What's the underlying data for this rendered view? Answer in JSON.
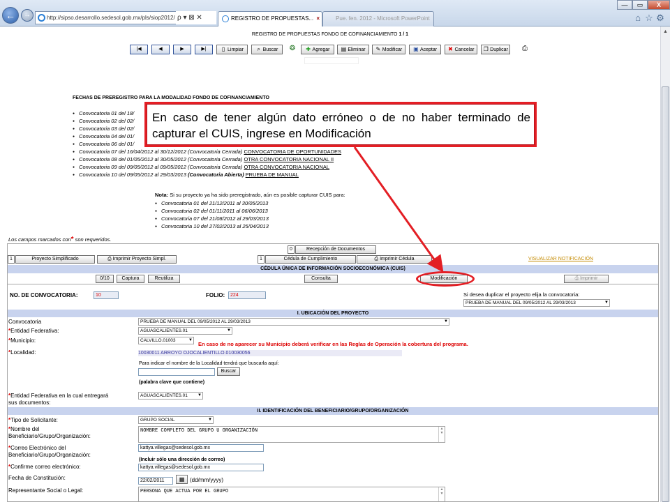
{
  "browser": {
    "address": "http://sipso.desarrollo.sedesol.gob.mx/pls/siop2012/",
    "address_suffix": "ρ ▾ ⊠ ✕",
    "active_tab": "REGISTRO DE PROPUESTAS...",
    "inactive_tab": "Pue. fen. 2012 - Microsoft PowerPoint",
    "window_controls": [
      "—",
      "▭",
      "X"
    ],
    "tool_icons": [
      "home-icon",
      "star-icon",
      "gear-icon"
    ],
    "back_glyph": "←",
    "forward_glyph": "→"
  },
  "page": {
    "title_prefix": "REGISTRO DE PROPUESTAS FONDO DE COFINANCIAMIENTO ",
    "title_page": "1 / 1",
    "toolbar": {
      "first": "|◀",
      "prev": "◀",
      "next": "▶",
      "last": "▶|",
      "limpiar": "Limpiar",
      "buscar": "Buscar",
      "agregar": "Agregar",
      "eliminar": "Eliminar",
      "modificar": "Modificar",
      "aceptar": "Aceptar",
      "cancelar": "Cancelar",
      "duplicar": "Duplicar"
    },
    "fechas_heading": "FECHAS DE PREREGISTRO PARA LA MODALIDAD FONDO DE COFINANCIAMIENTO",
    "convocatorias": [
      {
        "text": "Convocatoria 01 del 18/",
        "link": ""
      },
      {
        "text": "Convocatoria 02 del 02/",
        "link": ""
      },
      {
        "text": "Convocatoria 03 del 02/",
        "link": ""
      },
      {
        "text": "Convocatoria 04 del 01/",
        "link": ""
      },
      {
        "text": "Convocatoria 06 del 01/",
        "link": ""
      },
      {
        "text": "Convocatoria 07 del 16/04/2012 al 30/12/2012 (Convocatoria Cerrada) ",
        "link": "CONVOCATORIA DE OPORTUNIDADES"
      },
      {
        "text": "Convocatoria 08 del 01/05/2012 al 30/05/2012 (Convocatoria Cerrada) ",
        "link": "OTRA CONVOCATORIA NACIONAL II"
      },
      {
        "text": "Convocatoria 09 del 09/05/2012 al 09/05/2012 (Convocatoria Cerrada) ",
        "link": "OTRA CONVOCATORIA NACIONAL"
      },
      {
        "text": "Convocatoria 10 del 09/05/2012 al 29/03/2013 ",
        "bold": "(Convocatoria Abierta)",
        "link": "PRUEBA DE MANUAL"
      }
    ],
    "nota_label": "Nota:",
    "nota_text": " Si su proyecto ya ha sido preregistrado, aún es posible capturar CUIS para:",
    "nota_items": [
      "Convocatoria 01 del 21/12/2011 al 30/05/2013",
      "Convocatoria 02 del 01/11/2011 al 06/06/2013",
      "Convocatoria 07 del 21/08/2012 al 29/03/2013",
      "Convocatoria 10 del 27/02/2013 al 25/04/2013"
    ],
    "required_note_a": "Los campos marcados con",
    "required_note_star": "*",
    "required_note_b": " son requeridos."
  },
  "callout": {
    "text": "En caso de tener algún dato erróneo o de no haber terminado de capturar el CUIS, ingrese en Modificación"
  },
  "form": {
    "docs_count": "0",
    "recepcion": "Recepción de Documentos",
    "proj_count": "1",
    "proyecto_simplificado": "Proyecto Simplificado",
    "imprimir_proyecto": "Imprimir Proyecto Simpl.",
    "ced_count": "1",
    "cedula_cumplimiento": "Cédula de Cumplimiento",
    "imprimir_cedula": "Imprimir Cédula",
    "visualizar_notificacion": "VISUALIZAR NOTIFICACIÓN",
    "cuis_title": "CÉDULA ÚNICA DE INFORMACIÓN SOCIOECONÓMICA (CUIS)",
    "cuis_count": "0/10",
    "captura": "Captura",
    "reutiliza": "Reutiliza",
    "consulta": "Consulta",
    "modificacion": "Modificación",
    "imprimir": "Imprimir",
    "no_convocatoria_label": "NO. DE CONVOCATORIA:",
    "no_convocatoria_value": "10",
    "folio_label": "FOLIO:",
    "folio_value": "224",
    "duplicar_text": "Si desea duplicar el proyecto elija la convocatoria:",
    "duplicar_select": "PRUEBA DE MANUAL DEL 09/05/2012 AL 29/03/2013",
    "section1": "I. UBICACIÓN DEL PROYECTO",
    "convocatoria_label": "Convocatoria",
    "convocatoria_value": "PRUEBA DE MANUAL DEL 09/05/2012 AL 29/03/2013",
    "entidad_label": "Entidad Federativa:",
    "entidad_value": "AGUASCALIENTES.01",
    "municipio_label": "Municipio:",
    "municipio_value": "CALVILLO.01003",
    "municipio_msg": "En caso de no aparecer su Municipio deberá verificar en las Reglas de Operación la cobertura del programa.",
    "localidad_label": "Localidad:",
    "localidad_value": "10030011 ARROYO OJOCALIENTILLO.010030056",
    "localidad_hint": "Para indicar el nombre de la Localidad tendrá que buscarla aquí:",
    "buscar": "Buscar",
    "palabra_clave": "(palabra clave que contiene)",
    "entidad_docs_label_a": "Entidad Federativa en la cual entregará",
    "entidad_docs_label_b": "sus documentos:",
    "entidad_docs_value": "AGUASCALIENTES.01",
    "section2": "II. IDENTIFICACIÓN DEL BENEFICIARIO/GRUPO/ORGANIZACIÓN",
    "tipo_label": "Tipo de Solicitante:",
    "tipo_value": "GRUPO SOCIAL",
    "nombre_label_a": "Nombre del",
    "nombre_label_b": "Beneficiario/Grupo/Organización:",
    "nombre_value": "NOMBRE COMPLETO DEL GRUPO U ORGANIZACIÓN",
    "correo_label_a": "Correo Electrónico del",
    "correo_label_b": "Beneficiario/Grupo/Organización:",
    "correo_value": "kattya.villegas@sedesol.gob.mx",
    "correo_hint": "(Incluir sólo una dirección de correo)",
    "confirme_label": "Confirme correo electrónico:",
    "confirme_value": "kattya.villegas@sedesol.gob.mx",
    "fecha_label": "Fecha de Constitución:",
    "fecha_value": "22/02/2011",
    "fecha_fmt": "(dd/mm/yyyy)",
    "representante_label": "Representante Social o Legal:",
    "representante_value": "PERSONA QUE ACTUA POR EL GRUPO",
    "star": "*"
  },
  "colors": {
    "accent_red": "#e31e24",
    "section_band": "#c8d3ee",
    "link_orange": "#c48a00"
  }
}
